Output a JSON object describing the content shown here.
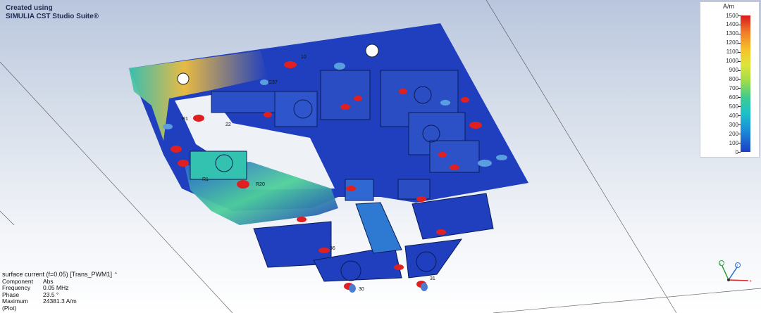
{
  "watermark": {
    "line1": "Created using",
    "line2": "SIMULIA CST Studio Suite®"
  },
  "legend": {
    "unit": "A/m",
    "ticks": [
      "1500",
      "1400",
      "1300",
      "1200",
      "1100",
      "1000",
      "900",
      "800",
      "700",
      "600",
      "500",
      "400",
      "300",
      "200",
      "100",
      "0"
    ]
  },
  "info": {
    "header": "surface current (f=0.05) [Trans_PWM1]",
    "rows": [
      {
        "k": "Component",
        "v": "Abs"
      },
      {
        "k": "Frequency",
        "v": "0.05 MHz"
      },
      {
        "k": "Phase",
        "v": "23.5 °"
      },
      {
        "k": "Maximum (Plot)",
        "v": "24381.3 A/m"
      }
    ]
  },
  "labels": [
    {
      "text": "10"
    },
    {
      "text": "C37"
    },
    {
      "text": "R1"
    },
    {
      "text": "22"
    },
    {
      "text": "R1"
    },
    {
      "text": "R20"
    },
    {
      "text": "30"
    },
    {
      "text": "31"
    },
    {
      "text": "36"
    }
  ],
  "axes": {
    "x": "x",
    "y": "y",
    "z": "z"
  },
  "colors": {
    "field_low": "#1f3fbf",
    "field_mid": "#3fcb8f",
    "field_high": "#d7191c",
    "highlight": "#e02020"
  }
}
